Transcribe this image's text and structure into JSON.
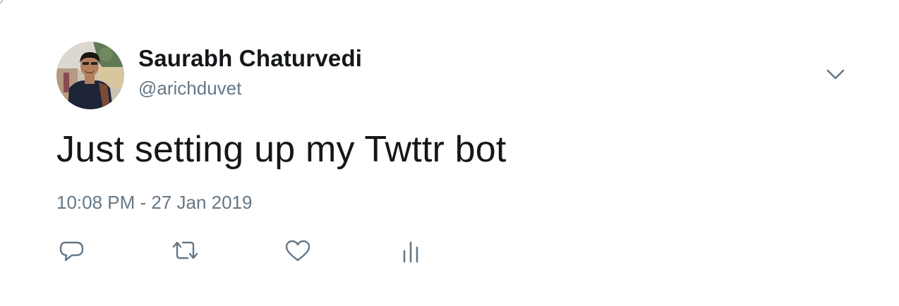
{
  "tweet": {
    "author": {
      "display_name": "Saurabh Chaturvedi",
      "handle": "@arichduvet",
      "avatar_icon": "profile-photo"
    },
    "text": "Just setting up my Twttr bot",
    "timestamp": "10:08 PM - 27 Jan 2019",
    "menu_icon": "chevron-down-icon",
    "actions": [
      {
        "name": "reply",
        "icon": "speech-bubble-icon"
      },
      {
        "name": "retweet",
        "icon": "retweet-arrows-icon"
      },
      {
        "name": "like",
        "icon": "heart-icon"
      },
      {
        "name": "analytics",
        "icon": "bar-chart-icon"
      }
    ]
  },
  "colors": {
    "primary_text": "#14171a",
    "secondary_text": "#657786",
    "icon": "#657786",
    "background": "#ffffff"
  }
}
